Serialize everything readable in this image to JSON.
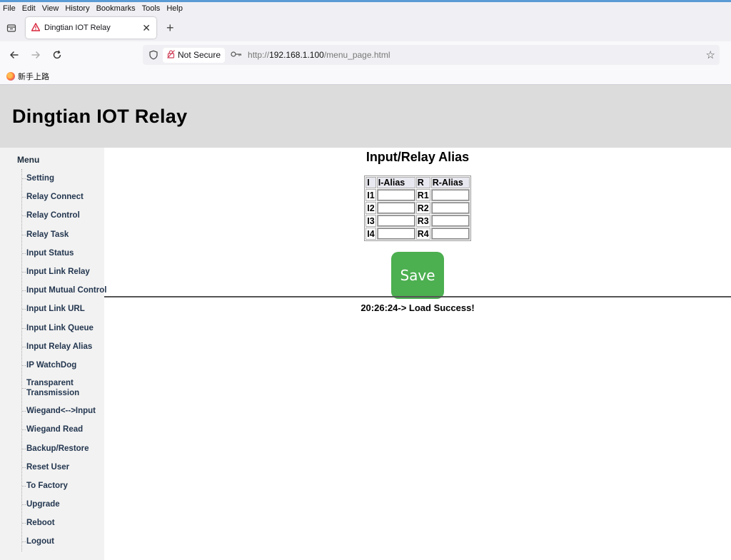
{
  "browser": {
    "menu": [
      "File",
      "Edit",
      "View",
      "History",
      "Bookmarks",
      "Tools",
      "Help"
    ],
    "tab_title": "Dingtian IOT Relay",
    "not_secure": "Not Secure",
    "url_prefix": "http://",
    "url_host": "192.168.1.100",
    "url_path": "/menu_page.html",
    "bookmark": "新手上路"
  },
  "header": {
    "title": "Dingtian IOT Relay"
  },
  "sidebar": {
    "title": "Menu",
    "items": [
      {
        "label": "Setting"
      },
      {
        "label": "Relay Connect"
      },
      {
        "label": "Relay Control"
      },
      {
        "label": "Relay Task"
      },
      {
        "label": "Input Status"
      },
      {
        "label": "Input Link Relay"
      },
      {
        "label": "Input Mutual Control"
      },
      {
        "label": "Input Link URL"
      },
      {
        "label": "Input Link Queue"
      },
      {
        "label": "Input Relay Alias"
      },
      {
        "label": "IP WatchDog"
      },
      {
        "label": "Transparent Transmission"
      },
      {
        "label": "Wiegand<-->Input"
      },
      {
        "label": "Wiegand Read"
      },
      {
        "label": "Backup/Restore"
      },
      {
        "label": "Reset User"
      },
      {
        "label": "To Factory"
      },
      {
        "label": "Upgrade"
      },
      {
        "label": "Reboot"
      },
      {
        "label": "Logout"
      }
    ]
  },
  "main": {
    "title": "Input/Relay Alias",
    "table": {
      "headers": [
        "I",
        "I-Alias",
        "R",
        "R-Alias"
      ],
      "rows": [
        {
          "i": "I1",
          "i_alias": "",
          "r": "R1",
          "r_alias": ""
        },
        {
          "i": "I2",
          "i_alias": "",
          "r": "R2",
          "r_alias": ""
        },
        {
          "i": "I3",
          "i_alias": "",
          "r": "R3",
          "r_alias": ""
        },
        {
          "i": "I4",
          "i_alias": "",
          "r": "R4",
          "r_alias": ""
        }
      ]
    },
    "save_label": "Save",
    "status": "20:26:24-> Load Success!"
  }
}
